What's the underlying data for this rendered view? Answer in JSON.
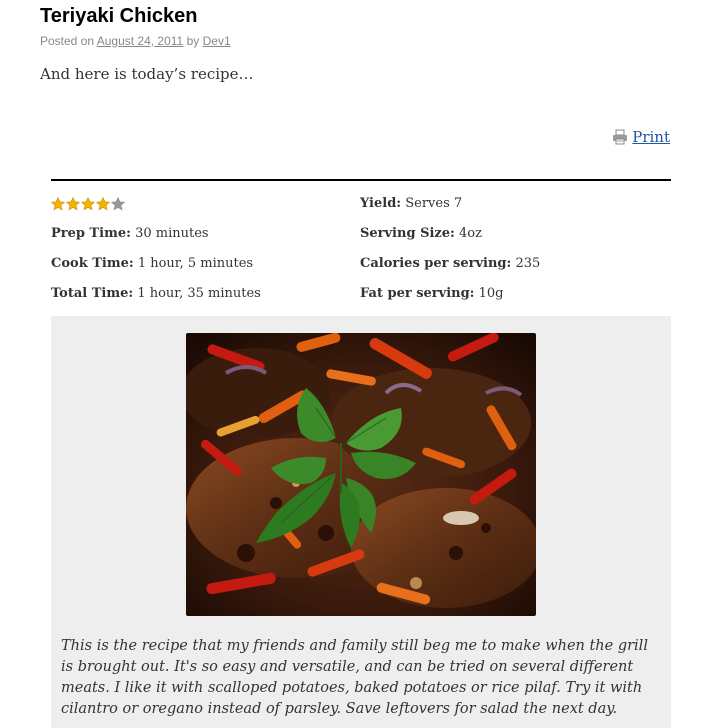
{
  "post": {
    "title": "Teriyaki Chicken",
    "posted_on_label": "Posted on",
    "date": "August 24, 2011",
    "by_label": "by",
    "author": "Dev1",
    "intro": "And here is today’s recipe…"
  },
  "print": {
    "label": "Print",
    "icon": "printer-icon"
  },
  "rating": {
    "value": 4,
    "max": 5,
    "filled_color": "#f5b400",
    "empty_color": "#999999"
  },
  "recipe": {
    "prep_time_label": "Prep Time:",
    "prep_time": "30 minutes",
    "cook_time_label": "Cook Time:",
    "cook_time": "1 hour, 5 minutes",
    "total_time_label": "Total Time:",
    "total_time": "1 hour, 35 minutes",
    "yield_label": "Yield:",
    "yield": "Serves 7",
    "serving_size_label": "Serving Size:",
    "serving_size": "4oz",
    "calories_label": "Calories per serving:",
    "calories": "235",
    "fat_label": "Fat per serving:",
    "fat": "10g"
  },
  "summary": "This is the recipe that my friends and family still beg me to make when the grill is brought out. It's so easy and versatile, and can be tried on several different meats. I like it with scalloped potatoes, baked potatoes or rice pilaf. Try it with cilantro or oregano instead of parsley. Save leftovers for salad the next day.",
  "colors": {
    "link": "#1d57a8",
    "panel_bg": "#eeeeee"
  }
}
